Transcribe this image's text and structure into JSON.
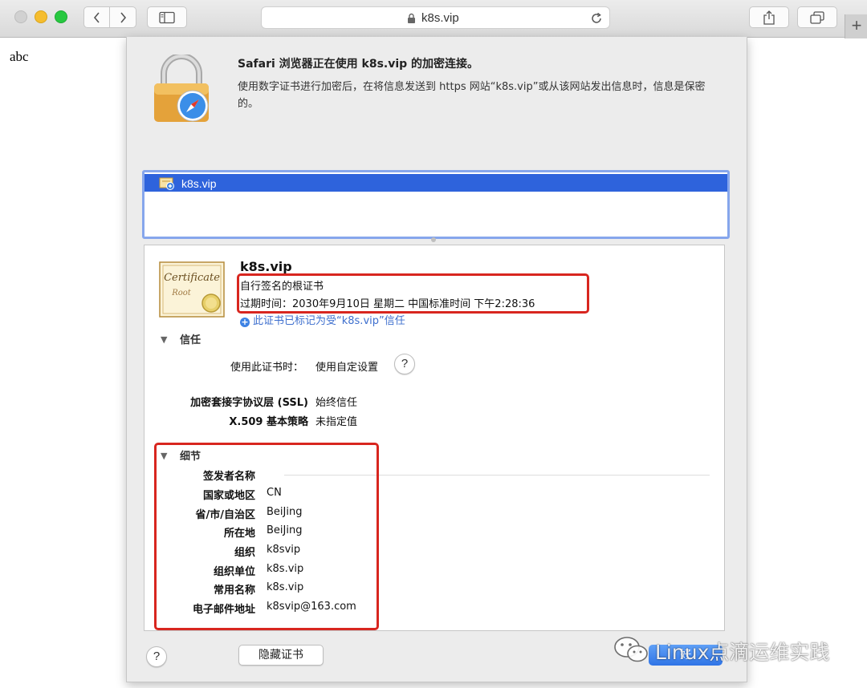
{
  "browser": {
    "url": "k8s.vip",
    "new_tab_label": "+"
  },
  "page": {
    "body_text": "abc"
  },
  "sheet": {
    "title": "Safari 浏览器正在使用 k8s.vip 的加密连接。",
    "description": "使用数字证书进行加密后，在将信息发送到 https 网站“k8s.vip”或从该网站发出信息时，信息是保密的。",
    "cert_list": [
      {
        "label": "k8s.vip",
        "selected": true
      }
    ],
    "certificate": {
      "name": "k8s.vip",
      "kind": "自行签名的根证书",
      "expiry": "过期时间：2030年9月10日 星期二 中国标准时间 下午2:28:36",
      "trust_note": "此证书已标记为受“k8s.vip”信任",
      "image_script": "Certificate",
      "image_sub": "Root"
    },
    "trust": {
      "section_label": "信任",
      "when_using_label": "使用此证书时：",
      "when_using_value": "使用自定设置",
      "help_symbol": "?",
      "rows": [
        {
          "label": "加密套接字协议层 (SSL)",
          "value": "始终信任"
        },
        {
          "label": "X.509 基本策略",
          "value": "未指定值"
        }
      ]
    },
    "details": {
      "section_label": "细节",
      "subject_heading": "签发者名称",
      "rows": [
        {
          "label": "国家或地区",
          "value": "CN"
        },
        {
          "label": "省/市/自治区",
          "value": "BeiJing"
        },
        {
          "label": "所在地",
          "value": "BeiJing"
        },
        {
          "label": "组织",
          "value": "k8svip"
        },
        {
          "label": "组织单位",
          "value": "k8s.vip"
        },
        {
          "label": "常用名称",
          "value": "k8s.vip"
        },
        {
          "label": "电子邮件地址",
          "value": "k8svip@163.com"
        }
      ]
    },
    "buttons": {
      "help": "?",
      "hide_cert": "隐藏证书",
      "ok": "好"
    }
  },
  "watermark": {
    "text": "Linux点滴运维实践"
  },
  "colors": {
    "selection_blue": "#2e63dc",
    "highlight_red": "#d8261f",
    "accent_blue": "#3e6fce"
  }
}
